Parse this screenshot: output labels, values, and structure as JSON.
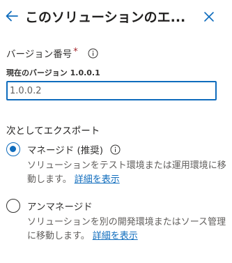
{
  "header": {
    "title": "このソリューションのエ...",
    "back_icon": "back-arrow-icon",
    "close_icon": "close-icon"
  },
  "version_field": {
    "label": "バージョン番号",
    "required_mark": "*",
    "current_version_text": "現在のバージョン 1.0.0.1",
    "value": "1.0.0.2"
  },
  "export_as": {
    "label": "次としてエクスポート",
    "options": [
      {
        "title": "マネージド (推奨)",
        "description": "ソリューションをテスト環境または運用環境に移動します。",
        "link": "詳細を表示",
        "selected": true
      },
      {
        "title": "アンマネージド",
        "description": "ソリューションを別の開発環境またはソース管理に移動します。",
        "link": "詳細を表示",
        "selected": false
      }
    ]
  },
  "colors": {
    "accent": "#0f6cbd",
    "required": "#a4262c",
    "text_primary": "#323130",
    "text_secondary": "#605e5c"
  }
}
